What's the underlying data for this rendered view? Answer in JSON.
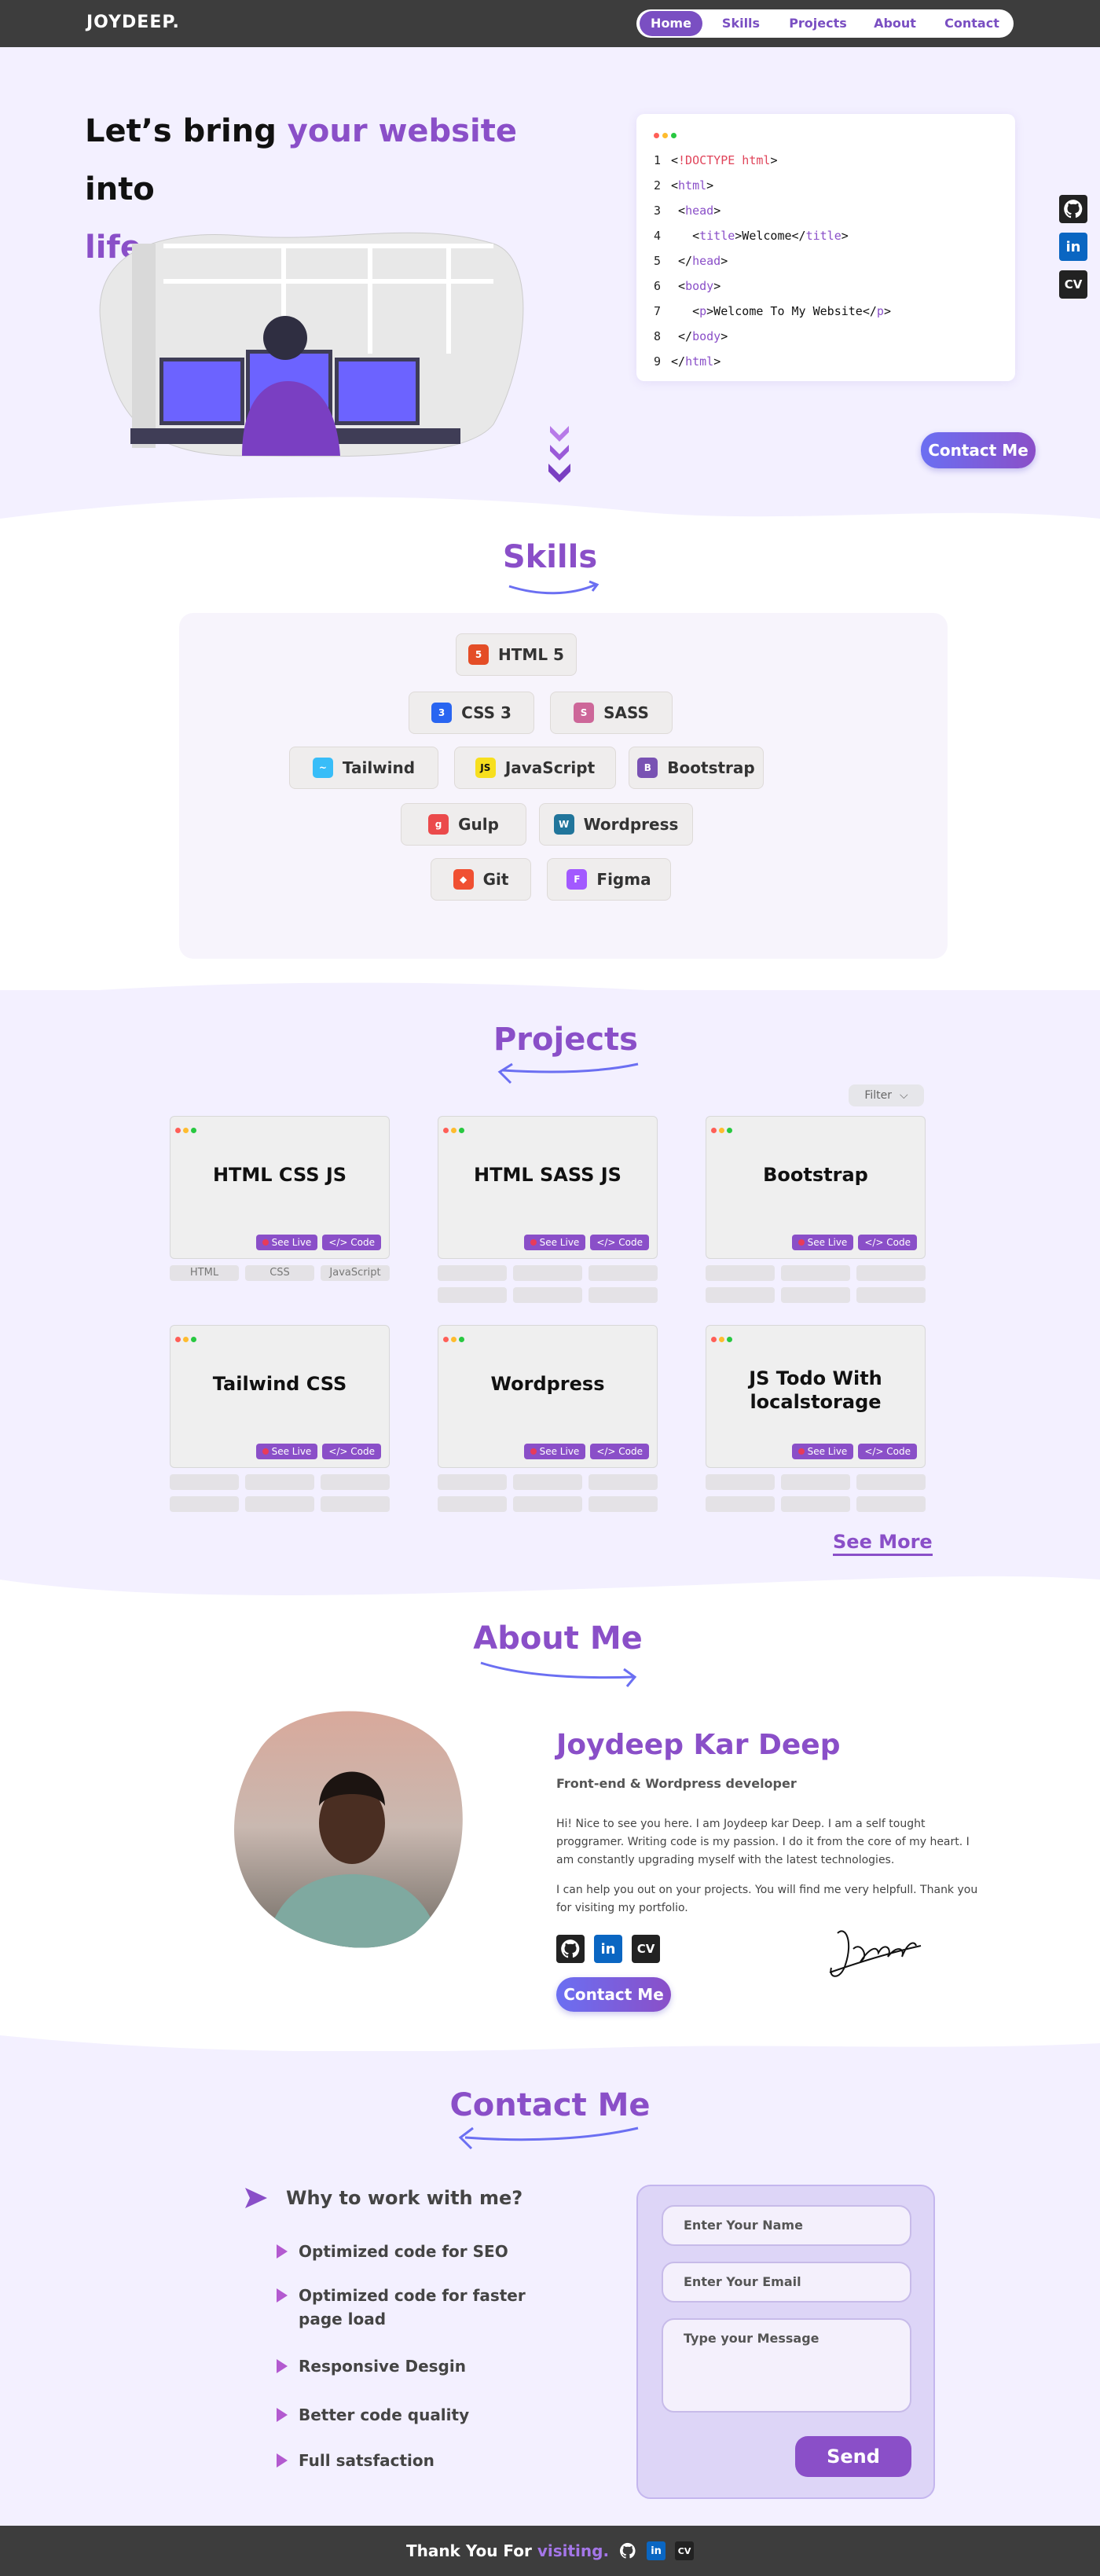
{
  "nav": {
    "logo": "JOYDEEP.",
    "items": [
      {
        "label": "Home",
        "active": true
      },
      {
        "label": "Skills"
      },
      {
        "label": "Projects"
      },
      {
        "label": "About"
      },
      {
        "label": "Contact"
      }
    ]
  },
  "hero": {
    "title_part1": "Let’s bring ",
    "title_highlight": "your website",
    "title_part2": " into",
    "title_line2_highlight": "life",
    "title_line2_end": " .",
    "contact_button": "Contact Me",
    "code": [
      {
        "num": "1",
        "pre": "<",
        "tag": "!DOCTYPE html",
        "post": ">"
      },
      {
        "num": "2",
        "pre": "<",
        "tag": "html",
        "post": ">"
      },
      {
        "num": "3",
        "pre": " <",
        "tag": "head",
        "post": ">"
      },
      {
        "num": "4",
        "pre": "   <",
        "tag": "title",
        "post": ">Welcome</",
        "tag2": "title",
        "post2": ">"
      },
      {
        "num": "5",
        "pre": " </",
        "tag": "head",
        "post": ">"
      },
      {
        "num": "6",
        "pre": " <",
        "tag": "body",
        "post": ">"
      },
      {
        "num": "7",
        "pre": "   <",
        "tag": "p",
        "post": ">Welcome To My Website</",
        "tag2": "p",
        "post2": ">"
      },
      {
        "num": "8",
        "pre": " </",
        "tag": "body",
        "post": ">"
      },
      {
        "num": "9",
        "pre": "</",
        "tag": "html",
        "post": ">"
      }
    ]
  },
  "social": {
    "github_icon": "github-icon",
    "linkedin_label": "in",
    "cv_label": "CV"
  },
  "skills": {
    "title": "Skills",
    "items": [
      {
        "label": "HTML 5",
        "icon": "5",
        "color": "#e44d26"
      },
      {
        "label": "CSS 3",
        "icon": "3",
        "color": "#2965f1"
      },
      {
        "label": "SASS",
        "icon": "S",
        "color": "#cd6799"
      },
      {
        "label": "Tailwind",
        "icon": "~",
        "color": "#38bdf8"
      },
      {
        "label": "JavaScript",
        "icon": "JS",
        "color": "#f7df1e"
      },
      {
        "label": "Bootstrap",
        "icon": "B",
        "color": "#7952b3"
      },
      {
        "label": "Gulp",
        "icon": "g",
        "color": "#eb4a4b"
      },
      {
        "label": "Wordpress",
        "icon": "W",
        "color": "#21759b"
      },
      {
        "label": "Git",
        "icon": "◆",
        "color": "#f05032"
      },
      {
        "label": "Figma",
        "icon": "F",
        "color": "#a259ff"
      }
    ]
  },
  "projects": {
    "title": "Projects",
    "filter": "Filter",
    "see_live": "See Live",
    "code": "</> Code",
    "see_more": "See More",
    "cards": [
      {
        "title": "HTML CSS JS",
        "tags": [
          "HTML",
          "CSS",
          "JavaScript"
        ]
      },
      {
        "title": "HTML  SASS JS",
        "tags": [
          "",
          "",
          ""
        ]
      },
      {
        "title": "Bootstrap",
        "tags": [
          "",
          "",
          ""
        ]
      },
      {
        "title": "Tailwind CSS",
        "tags": [
          "",
          "",
          ""
        ]
      },
      {
        "title": "Wordpress",
        "tags": [
          "",
          "",
          ""
        ]
      },
      {
        "title": "JS Todo With localstorage",
        "tags": [
          "",
          "",
          ""
        ]
      }
    ]
  },
  "about": {
    "title": "About Me",
    "name": "Joydeep Kar Deep",
    "role": "Front-end & Wordpress developer",
    "p1": "Hi! Nice to see you here. I am Joydeep kar Deep. I am a self tought proggramer. Writing code is my passion. I do it from the core of my heart. I am constantly upgrading myself with the latest technologies.",
    "p2": "I can help you out on your projects. You will find me very helpfull. Thank you for visiting my portfolio.",
    "contact_button": "Contact Me",
    "signature": "Joydeep"
  },
  "contact": {
    "title": "Contact Me",
    "why": "Why to work with me?",
    "reasons": [
      "Optimized code for SEO",
      "Optimized code for faster page load",
      "Responsive Desgin",
      "Better code quality",
      "Full satsfaction"
    ],
    "name_placeholder": "Enter Your Name",
    "email_placeholder": "Enter Your Email",
    "message_placeholder": "Type your Message",
    "send": "Send"
  },
  "footer": {
    "text": "Thank You For ",
    "highlight": "visiting."
  },
  "colors": {
    "accent": "#8a4fc8",
    "nav_bg": "#3d3d3d",
    "page_bg": "#f3f0ff"
  }
}
